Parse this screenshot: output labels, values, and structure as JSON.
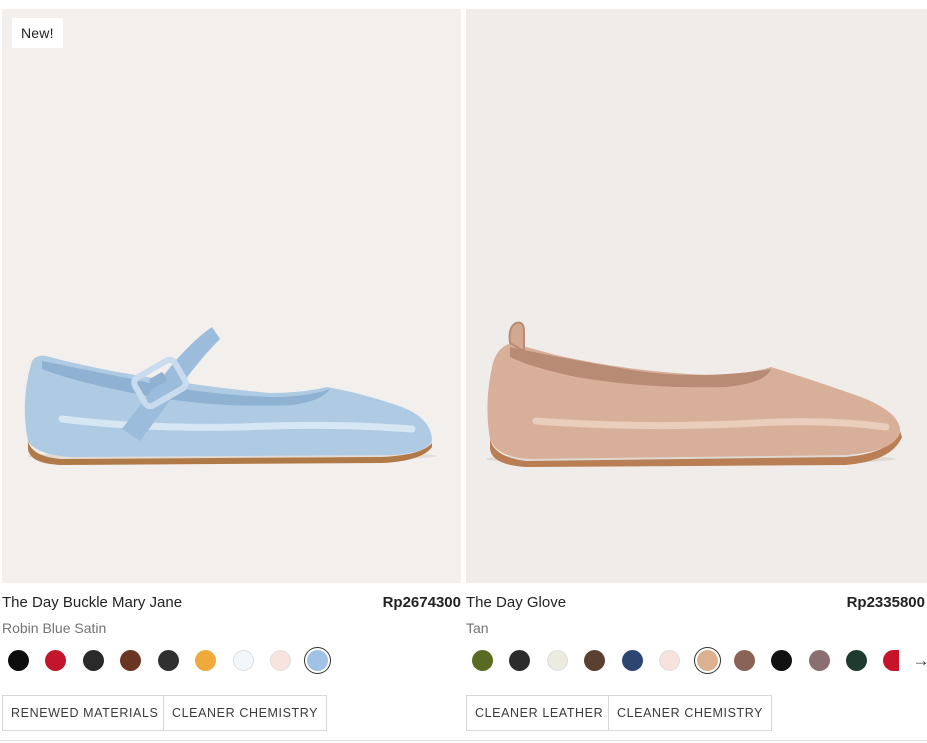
{
  "products": [
    {
      "badge": "New!",
      "name": "The Day Buckle Mary Jane",
      "price": "Rp2674300",
      "variant": "Robin Blue Satin",
      "swatches": [
        {
          "name": "black",
          "color": "#0d0d0d"
        },
        {
          "name": "red",
          "color": "#c3152b"
        },
        {
          "name": "charcoal",
          "color": "#2a2a2a"
        },
        {
          "name": "brown",
          "color": "#6b3523"
        },
        {
          "name": "dark-gray",
          "color": "#303030"
        },
        {
          "name": "marigold",
          "color": "#f0a93c"
        },
        {
          "name": "white",
          "color": "#f4f7fa"
        },
        {
          "name": "blush",
          "color": "#f8e3de"
        },
        {
          "name": "robin-blue",
          "color": "#9fc2e5",
          "selected": true
        }
      ],
      "tags": [
        "RENEWED MATERIALS",
        "CLEANER CHEMISTRY"
      ]
    },
    {
      "badge": "",
      "name": "The Day Glove",
      "price": "Rp2335800",
      "variant": "Tan",
      "swatches": [
        {
          "name": "olive",
          "color": "#5b6a22"
        },
        {
          "name": "charcoal",
          "color": "#2c2c2c"
        },
        {
          "name": "bone",
          "color": "#ecebe0"
        },
        {
          "name": "chocolate",
          "color": "#5a4030"
        },
        {
          "name": "navy",
          "color": "#2e4572"
        },
        {
          "name": "blush",
          "color": "#f8e3dc"
        },
        {
          "name": "tan",
          "color": "#dcb18f",
          "selected": true
        },
        {
          "name": "mocha",
          "color": "#8a6357"
        },
        {
          "name": "black",
          "color": "#111111"
        },
        {
          "name": "mauve",
          "color": "#8b6e72"
        },
        {
          "name": "forest",
          "color": "#1f3a2e"
        },
        {
          "name": "red",
          "color": "#c8142b"
        }
      ],
      "more_icon": "arrow-right-icon",
      "more_label": "→",
      "tags": [
        "CLEANER LEATHER",
        "CLEANER CHEMISTRY"
      ]
    }
  ]
}
